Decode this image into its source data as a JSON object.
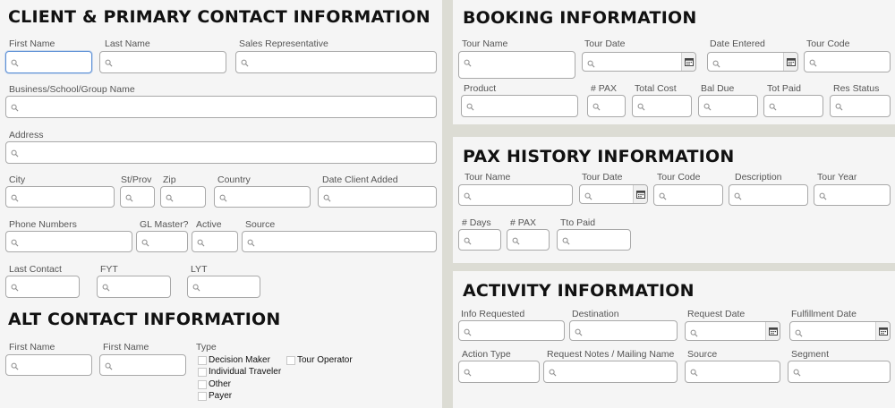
{
  "client": {
    "heading": "CLIENT & PRIMARY CONTACT INFORMATION",
    "first_name": "First Name",
    "last_name": "Last Name",
    "sales_rep": "Sales Representative",
    "business": "Business/School/Group Name",
    "address": "Address",
    "city": "City",
    "st_prov": "St/Prov",
    "zip": "Zip",
    "country": "Country",
    "date_client_added": "Date Client Added",
    "phone": "Phone Numbers",
    "gl_master": "GL Master?",
    "active": "Active",
    "source": "Source",
    "last_contact": "Last Contact",
    "fyt": "FYT",
    "lyt": "LYT"
  },
  "alt": {
    "heading": "ALT CONTACT INFORMATION",
    "first_name_1": "First Name",
    "first_name_2": "First Name",
    "type": "Type",
    "options": [
      "Decision Maker",
      "Tour Operator",
      "Individual Traveler",
      "Other",
      "Payer"
    ]
  },
  "booking": {
    "heading": "BOOKING INFORMATION",
    "tour_name": "Tour Name",
    "tour_date": "Tour Date",
    "date_entered": "Date Entered",
    "tour_code": "Tour Code",
    "product": "Product",
    "pax": "# PAX",
    "total_cost": "Total Cost",
    "bal_due": "Bal Due",
    "tot_paid": "Tot Paid",
    "res_status": "Res Status"
  },
  "pax_history": {
    "heading": "PAX HISTORY INFORMATION",
    "tour_name": "Tour Name",
    "tour_date": "Tour Date",
    "tour_code": "Tour Code",
    "description": "Description",
    "tour_year": "Tour Year",
    "days": "# Days",
    "pax": "# PAX",
    "tto_paid": "Tto Paid"
  },
  "activity": {
    "heading": "ACTIVITY INFORMATION",
    "info_requested": "Info Requested",
    "destination": "Destination",
    "request_date": "Request Date",
    "fulfillment_date": "Fulfillment Date",
    "action_type": "Action Type",
    "request_notes": "Request Notes / Mailing Name",
    "source": "Source",
    "segment": "Segment"
  },
  "icons": {
    "field": "magnifier-icon",
    "date": "calendar-icon"
  },
  "colors": {
    "panel": "#f5f5f5",
    "gap": "#dcdcd4",
    "focus": "#5b8fd6"
  }
}
